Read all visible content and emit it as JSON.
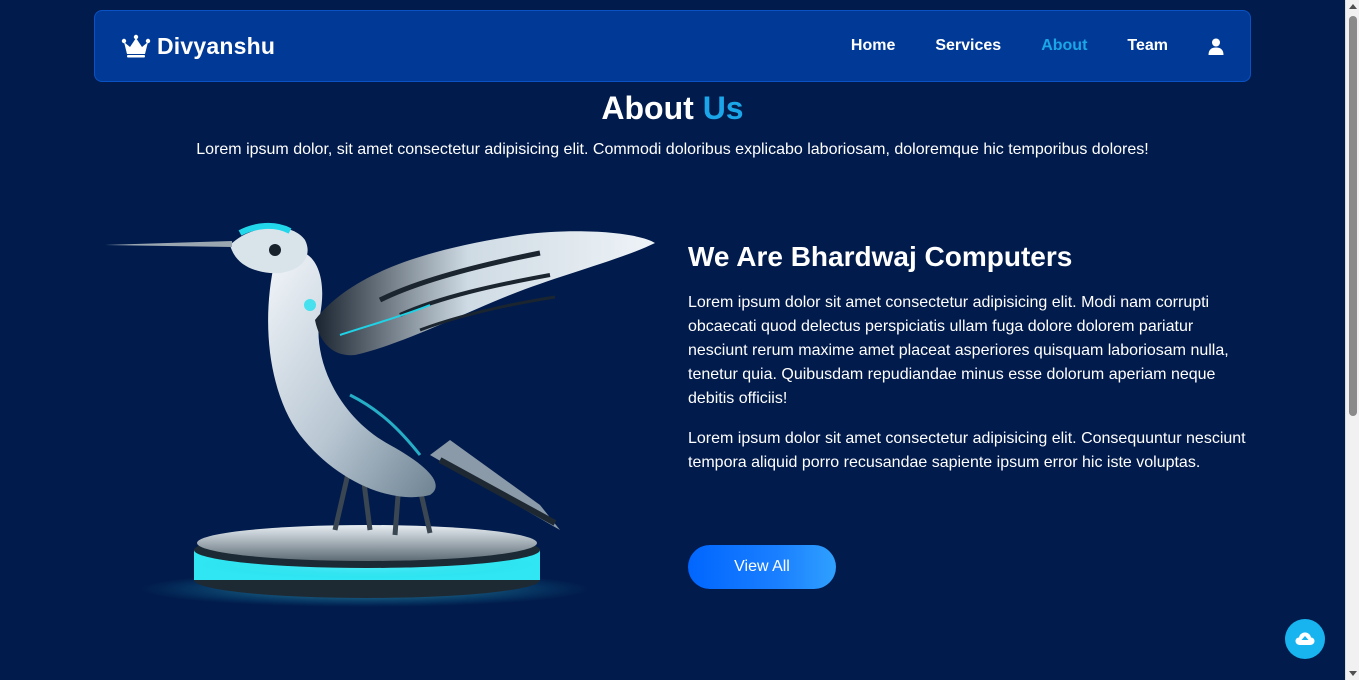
{
  "brand": {
    "name": "Divyanshu",
    "icon": "crown-icon"
  },
  "nav": {
    "items": [
      {
        "label": "Home",
        "active": false
      },
      {
        "label": "Services",
        "active": false
      },
      {
        "label": "About",
        "active": true
      },
      {
        "label": "Team",
        "active": false
      }
    ],
    "user_icon": "user-icon"
  },
  "section": {
    "title_main": "About",
    "title_accent": "Us",
    "subtitle": "Lorem ipsum dolor, sit amet consectetur adipisicing elit. Commodi doloribus explicabo laboriosam, doloremque hic temporibus dolores!"
  },
  "about": {
    "heading": "We Are Bhardwaj Computers",
    "paragraph1": "Lorem ipsum dolor sit amet consectetur adipisicing elit. Modi nam corrupti obcaecati quod delectus perspiciatis ullam fuga dolore dolorem pariatur nesciunt rerum maxime amet placeat asperiores quisquam laboriosam nulla, tenetur quia. Quibusdam repudiandae minus esse dolorum aperiam neque debitis officiis!",
    "paragraph2": "Lorem ipsum dolor sit amet consectetur adipisicing elit. Consequuntur nesciunt tempora aliquid porro recusandae sapiente ipsum error hic iste voluptas.",
    "button_label": "View All"
  },
  "image": {
    "subject": "robotic-hummingbird-on-glowing-pedestal"
  },
  "back_to_top": {
    "icon": "cloud-upload-icon"
  },
  "colors": {
    "background": "#011b4c",
    "navbar": "#003a96",
    "accent": "#1aa6e8",
    "button": "#0066ff",
    "to_top": "#17b4f0"
  }
}
